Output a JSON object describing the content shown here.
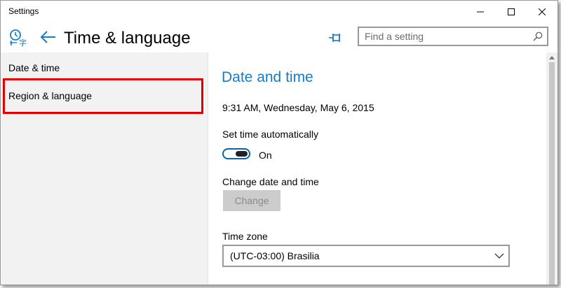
{
  "window": {
    "title": "Settings"
  },
  "header": {
    "page_title": "Time & language",
    "search_placeholder": "Find a setting"
  },
  "sidebar": {
    "items": [
      {
        "label": "Date & time"
      },
      {
        "label": "Region & language"
      }
    ]
  },
  "main": {
    "section_title": "Date and time",
    "current_datetime": "9:31 AM, Wednesday, May 6, 2015",
    "set_time_auto_label": "Set time automatically",
    "set_time_auto_state": "On",
    "change_label": "Change date and time",
    "change_button": "Change",
    "timezone_label": "Time zone",
    "timezone_value": "(UTC-03:00) Brasilia"
  },
  "colors": {
    "accent": "#1b7bc0",
    "highlight": "#e00000",
    "sidebar_bg": "#f2f2f2",
    "toggle_border": "#0a62a8"
  },
  "icons": {
    "app": "time-language-icon",
    "back": "back-arrow-icon",
    "pin": "pin-icon",
    "search": "search-icon",
    "minimize": "minimize-icon",
    "maximize": "maximize-icon",
    "close": "close-icon",
    "dropdown": "chevron-down-icon"
  }
}
